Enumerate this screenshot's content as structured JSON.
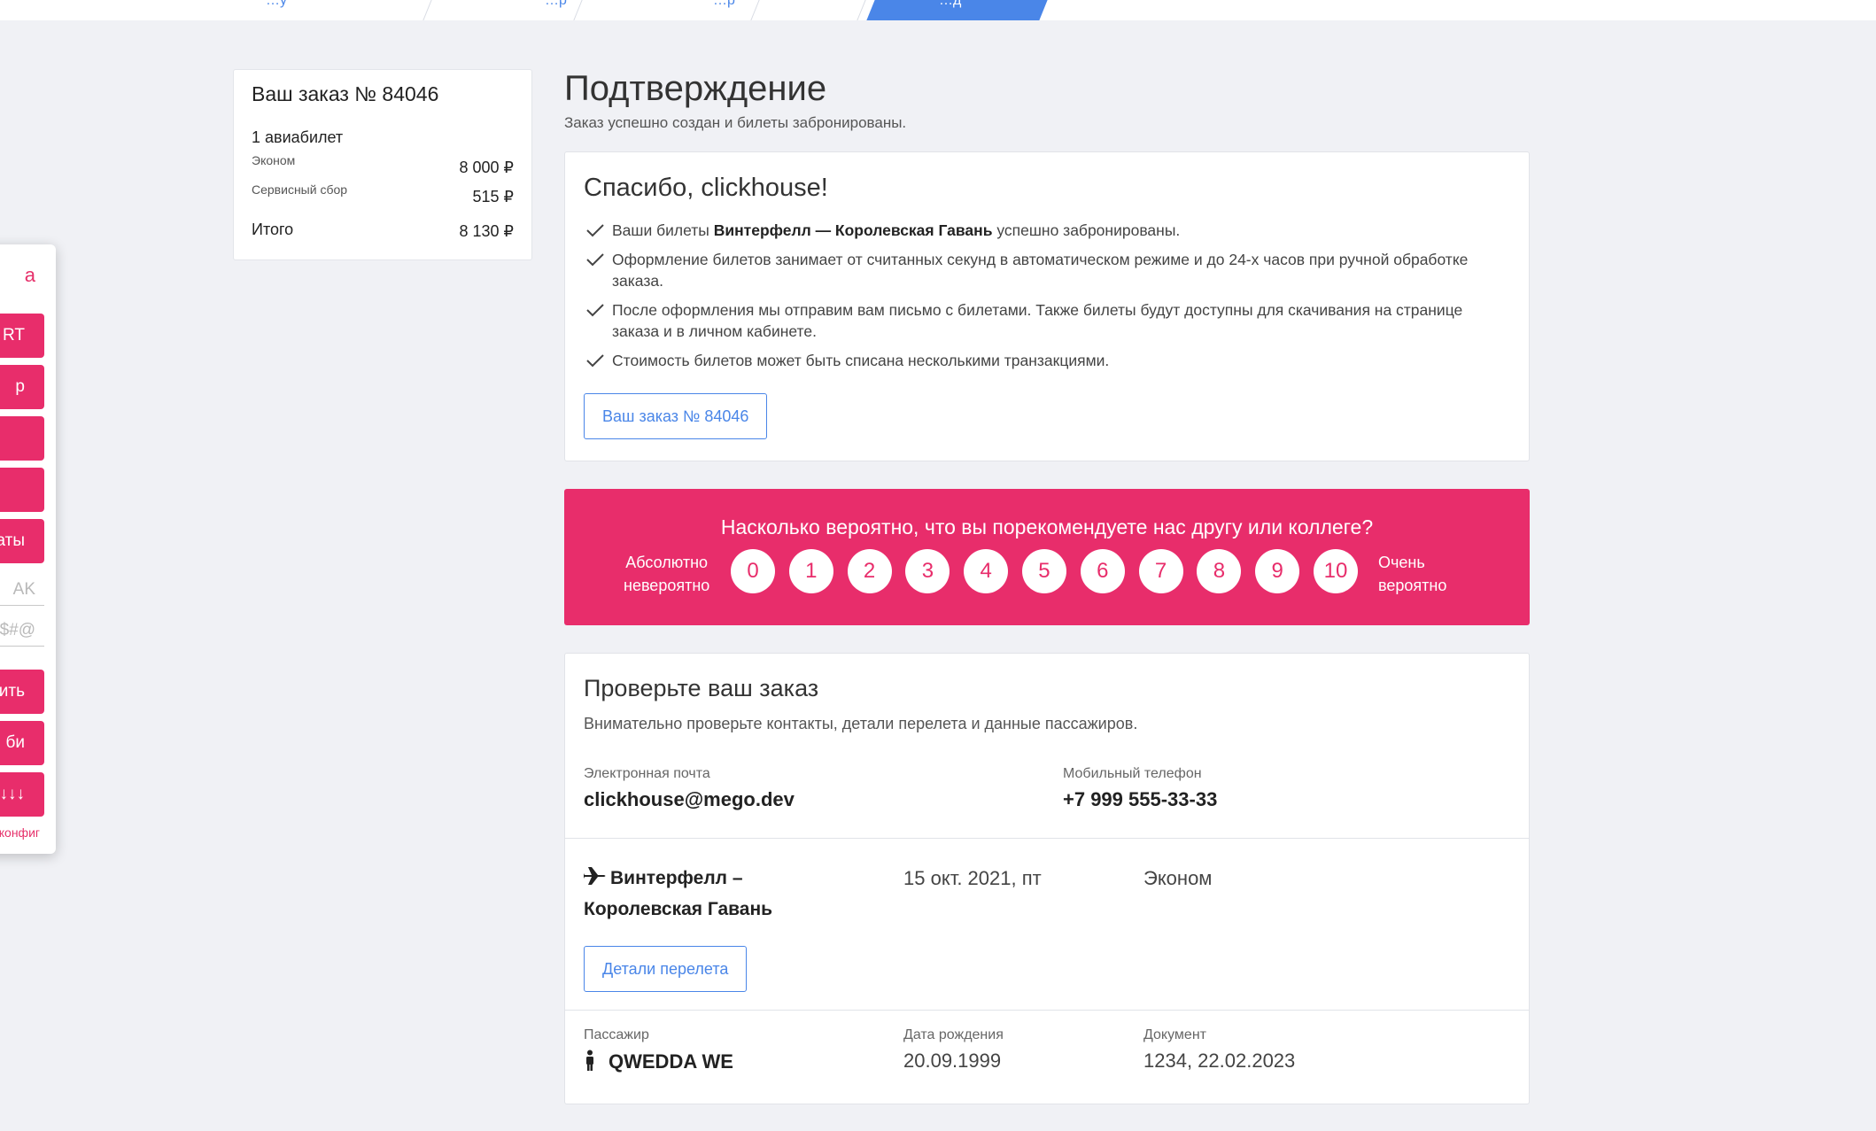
{
  "steps": [
    {
      "label": "…у"
    },
    {
      "label": "…р"
    },
    {
      "label": "…р"
    },
    {
      "label": ""
    },
    {
      "label": "…д"
    }
  ],
  "side_panel": {
    "title": "а",
    "buttons": [
      "RT",
      "р",
      "",
      "",
      "аты"
    ],
    "input1_placeholder": "AK",
    "input2_placeholder": "@#$*",
    "buttons2": [
      "ить",
      "би",
      "↓↓↓"
    ],
    "link": "конфиг"
  },
  "summary": {
    "title": "Ваш заказ № 84046",
    "count": "1 авиабилет",
    "rows": [
      {
        "label": "Эконом",
        "value": "8 000 ₽"
      },
      {
        "label": "Сервисный сбор",
        "value": "515 ₽"
      }
    ],
    "total_label": "Итого",
    "total_value": "8 130 ₽"
  },
  "header": {
    "title": "Подтверждение",
    "subtitle": "Заказ успешно создан и билеты забронированы."
  },
  "thanks": {
    "title": "Спасибо, clickhouse!",
    "item1_pre": "Ваши билеты ",
    "item1_route": "Винтерфелл — Королевская Гавань",
    "item1_post": " успешно забронированы.",
    "item2": "Оформление билетов занимает от считанных секунд в автоматическом режиме и до 24-х часов при ручной обработке заказа.",
    "item3": "После оформления мы отправим вам письмо с билетами. Также билеты будут доступны для скачивания на странице заказа и в личном кабинете.",
    "item4": "Стоимость билетов может быть списана несколькими транзакциями.",
    "order_button": "Ваш заказ № 84046"
  },
  "nps": {
    "question": "Насколько вероятно, что вы порекомендуете нас другу или коллеге?",
    "left_label_1": "Абсолютно",
    "left_label_2": "невероятно",
    "right_label_1": "Очень",
    "right_label_2": "вероятно",
    "scores": [
      "0",
      "1",
      "2",
      "3",
      "4",
      "5",
      "6",
      "7",
      "8",
      "9",
      "10"
    ]
  },
  "check": {
    "title": "Проверьте ваш заказ",
    "subtitle": "Внимательно проверьте контакты, детали перелета и данные пассажиров.",
    "email_label": "Электронная почта",
    "email": "clickhouse@mego.dev",
    "phone_label": "Мобильный телефон",
    "phone": "+7 999 555-33-33",
    "route_line1": "Винтерфелл  –",
    "route_line2": "Королевская Гавань",
    "date": "15 окт. 2021, пт",
    "class": "Эконом",
    "details_button": "Детали перелета",
    "pax_label": "Пассажир",
    "pax_name": "QWEDDA WE",
    "dob_label": "Дата рождения",
    "dob": "20.09.1999",
    "doc_label": "Документ",
    "doc": "1234, 22.02.2023"
  },
  "colors": {
    "accent_pink": "#e82d6b",
    "accent_blue": "#4a86e8",
    "background": "#f0f1f5"
  }
}
